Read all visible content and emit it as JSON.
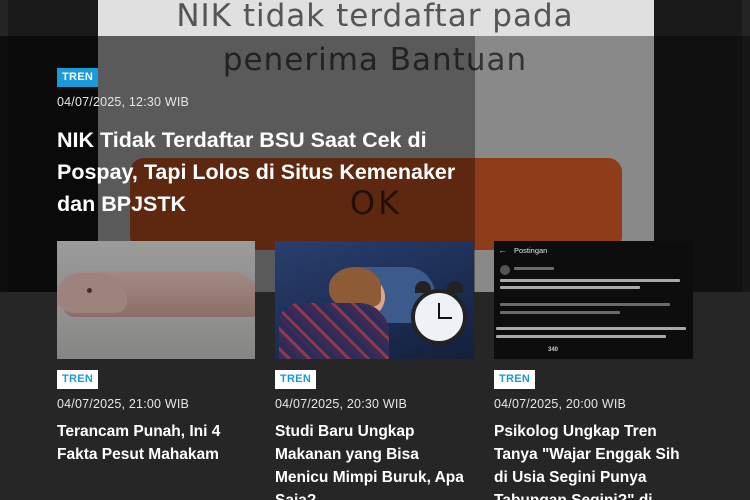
{
  "hero_background": {
    "dialog_text_line1": "NIK tidak terdaftar pada",
    "dialog_text_line2": "penerima Bantuan",
    "ok_label": "OK"
  },
  "featured": {
    "tag": "TREN",
    "date": "04/07/2025, 12:30 WIB",
    "title": "NIK Tidak Terdaftar BSU Saat Cek di Pospay, Tapi Lolos di Situs Kemenaker dan BPJSTK"
  },
  "cards": [
    {
      "tag": "TREN",
      "date": "04/07/2025, 21:00 WIB",
      "title": "Terancam Punah, Ini 4 Fakta Pesut Mahakam"
    },
    {
      "tag": "TREN",
      "date": "04/07/2025, 20:30 WIB",
      "title": "Studi Baru Ungkap Makanan yang Bisa Menicu Mimpi Buruk, Apa Saja?"
    },
    {
      "tag": "TREN",
      "date": "04/07/2025, 20:00 WIB",
      "title": "Psikolog Ungkap Tren Tanya \"Wajar Enggak Sih di Usia Segini Punya Tabungan Segini?\" di"
    }
  ],
  "thumb3_post": {
    "header": "Postingan",
    "views": "340"
  },
  "colors": {
    "accent": "#1a9ad6",
    "background": "#262626",
    "ok_button": "#f4682c"
  },
  "icons": [
    "back-arrow-icon",
    "clock-icon"
  ]
}
